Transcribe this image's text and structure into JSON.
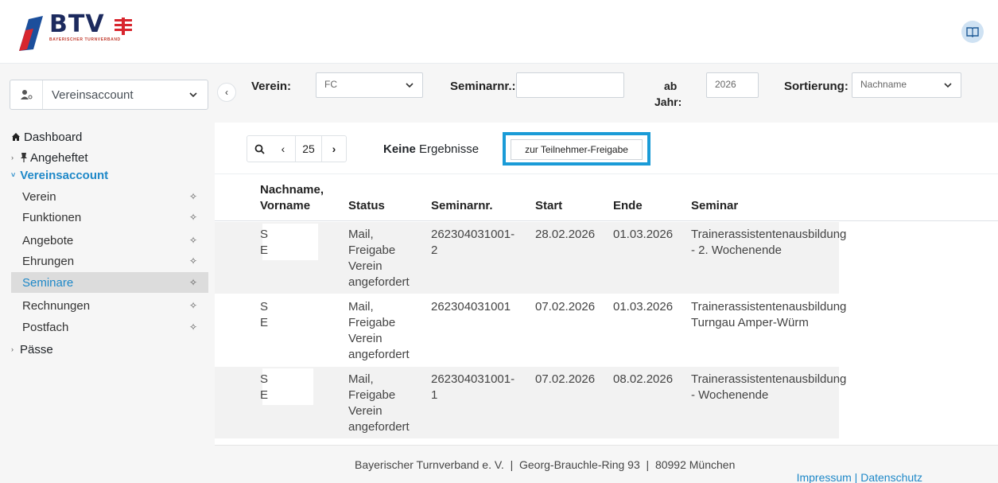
{
  "brand": {
    "name": "BTV",
    "subtitle": "BAYERISCHER TURNVERBAND",
    "accent": "#1a9bd7"
  },
  "sidebar": {
    "account_select": "Vereinsaccount",
    "nav": {
      "dashboard": "Dashboard",
      "angeheftet": "Angeheftet",
      "vereinsaccount": "Vereinsaccount",
      "items": [
        {
          "label": "Verein"
        },
        {
          "label": "Funktionen"
        },
        {
          "label": "Angebote"
        },
        {
          "label": "Ehrungen"
        },
        {
          "label": "Seminare",
          "active": true
        },
        {
          "label": "Rechnungen"
        },
        {
          "label": "Postfach"
        }
      ],
      "paesse": "Pässe"
    }
  },
  "filters": {
    "verein_label": "Verein:",
    "verein_value": "FC",
    "seminarnr_label": "Seminarnr.:",
    "seminarnr_value": "",
    "ab_jahr_label_1": "ab",
    "ab_jahr_label_2": "Jahr:",
    "ab_jahr_value": "2026",
    "sortierung_label": "Sortierung:",
    "sortierung_value": "Nachname"
  },
  "toolbar": {
    "page_size": "25",
    "results_bold": "Keine",
    "results_rest": " Ergebnisse",
    "freigabe_button": "zur Teilnehmer-Freigabe"
  },
  "table": {
    "headers": {
      "name_1": "Nachname,",
      "name_2": "Vorname",
      "status": "Status",
      "seminarnr": "Seminarnr.",
      "start": "Start",
      "ende": "Ende",
      "seminar": "Seminar"
    },
    "rows": [
      {
        "nachname": "S",
        "vorname": "E",
        "status": [
          "Mail,",
          "Freigabe",
          "Verein",
          "angefordert"
        ],
        "seminarnr": [
          "262304031001-",
          "2"
        ],
        "start": "28.02.2026",
        "ende": "01.03.2026",
        "seminar": [
          "Trainerassistentenausbildung",
          "- 2. Wochenende"
        ]
      },
      {
        "nachname": "S",
        "vorname": "E",
        "status": [
          "Mail,",
          "Freigabe",
          "Verein",
          "angefordert"
        ],
        "seminarnr": [
          "262304031001",
          ""
        ],
        "start": "07.02.2026",
        "ende": "01.03.2026",
        "seminar": [
          "Trainerassistentenausbildung",
          "Turngau Amper-Würm"
        ]
      },
      {
        "nachname": "S",
        "vorname": "E",
        "status": [
          "Mail,",
          "Freigabe",
          "Verein",
          "angefordert"
        ],
        "seminarnr": [
          "262304031001-",
          "1"
        ],
        "start": "07.02.2026",
        "ende": "08.02.2026",
        "seminar": [
          "Trainerassistentenausbildung",
          "- Wochenende"
        ]
      }
    ]
  },
  "footer": {
    "address": "Bayerischer Turnverband e. V.  |  Georg-Brauchle-Ring 93  |  80992 München",
    "impressum": "Impressum",
    "sep": " | ",
    "datenschutz": "Datenschutz"
  }
}
